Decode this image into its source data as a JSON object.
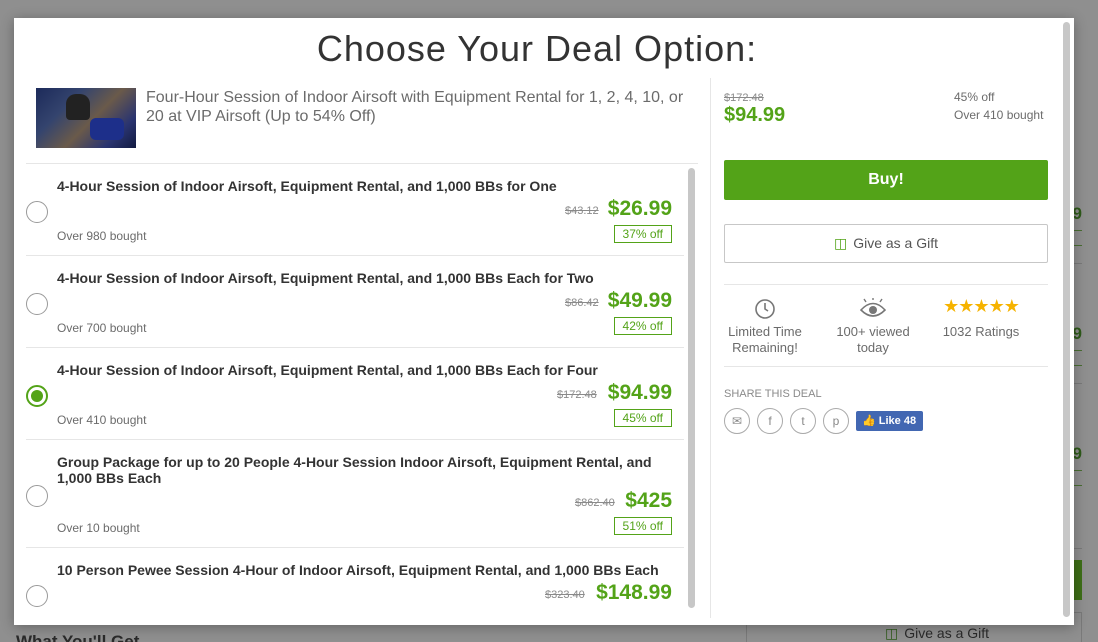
{
  "modal": {
    "title": "Choose Your Deal Option:",
    "deal_title": "Four-Hour Session of Indoor Airsoft with Equipment Rental for 1, 2, 4, 10, or 20 at VIP Airsoft (Up to 54% Off)"
  },
  "options": [
    {
      "title": "4-Hour Session of Indoor Airsoft, Equipment Rental, and 1,000 BBs for One",
      "old_price": "$43.12",
      "price": "$26.99",
      "bought": "Over 980 bought",
      "off": "37% off",
      "selected": false
    },
    {
      "title": "4-Hour Session of Indoor Airsoft, Equipment Rental, and 1,000 BBs Each for Two",
      "old_price": "$86.42",
      "price": "$49.99",
      "bought": "Over 700 bought",
      "off": "42% off",
      "selected": false
    },
    {
      "title": "4-Hour Session of Indoor Airsoft, Equipment Rental, and 1,000 BBs Each for Four",
      "old_price": "$172.48",
      "price": "$94.99",
      "bought": "Over 410 bought",
      "off": "45% off",
      "selected": true
    },
    {
      "title": "Group Package for up to 20 People 4-Hour Session Indoor Airsoft, Equipment Rental, and 1,000 BBs Each",
      "old_price": "$862.40",
      "price": "$425",
      "bought": "Over 10 bought",
      "off": "51% off",
      "selected": false
    },
    {
      "title": "10 Person Pewee Session 4-Hour of Indoor Airsoft, Equipment Rental, and 1,000 BBs Each",
      "old_price": "$323.40",
      "price": "$148.99",
      "bought": "",
      "off": "",
      "selected": false
    }
  ],
  "summary": {
    "old_price": "$172.48",
    "price": "$94.99",
    "off": "45% off",
    "bought": "Over 410 bought",
    "buy_label": "Buy!",
    "gift_label": "Give as a Gift"
  },
  "features": {
    "time": {
      "icon": "clock-icon",
      "label": "Limited Time Remaining!"
    },
    "views": {
      "icon": "eye-icon",
      "label": "100+ viewed today"
    },
    "ratings": {
      "icon": "stars-icon",
      "label": "1032 Ratings"
    }
  },
  "share": {
    "label": "SHARE THIS DEAL",
    "icons": [
      "email-icon",
      "facebook-icon",
      "twitter-icon",
      "pinterest-icon"
    ],
    "like_label": "Like",
    "like_count": "48"
  },
  "background": {
    "price_fragment": "9",
    "gift_label": "Give as a Gift",
    "heading_fragment": "What You'll Get"
  },
  "colors": {
    "accent": "#53a318",
    "star": "#f6b300",
    "facebook": "#4267b2"
  }
}
